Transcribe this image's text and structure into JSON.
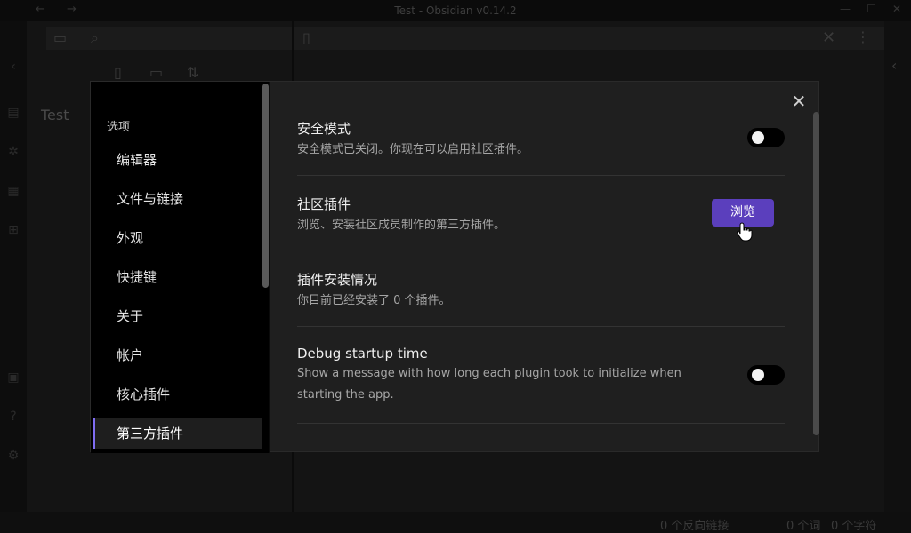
{
  "window": {
    "title": "Test - Obsidian v0.14.2"
  },
  "vault": {
    "name": "Test"
  },
  "statusbar": {
    "backlinks": "0 个反向链接",
    "words": "0 个词",
    "chars": "0 个字符"
  },
  "settings_nav": {
    "header": "选项",
    "items": [
      {
        "label": "编辑器"
      },
      {
        "label": "文件与链接"
      },
      {
        "label": "外观"
      },
      {
        "label": "快捷键"
      },
      {
        "label": "关于"
      },
      {
        "label": "帐户"
      },
      {
        "label": "核心插件"
      },
      {
        "label": "第三方插件",
        "active": true
      }
    ]
  },
  "settings": {
    "safe_mode": {
      "name": "安全模式",
      "desc": "安全模式已关闭。你现在可以启用社区插件。",
      "enabled": false
    },
    "community_plugins": {
      "name": "社区插件",
      "desc": "浏览、安装社区成员制作的第三方插件。",
      "button": "浏览"
    },
    "installed": {
      "name": "插件安装情况",
      "desc": "你目前已经安装了 0 个插件。"
    },
    "debug_startup": {
      "name": "Debug startup time",
      "desc": "Show a message with how long each plugin took to initialize when starting the app.",
      "enabled": false
    }
  },
  "colors": {
    "accent": "#7f6df2",
    "button": "#5b3fbd"
  }
}
